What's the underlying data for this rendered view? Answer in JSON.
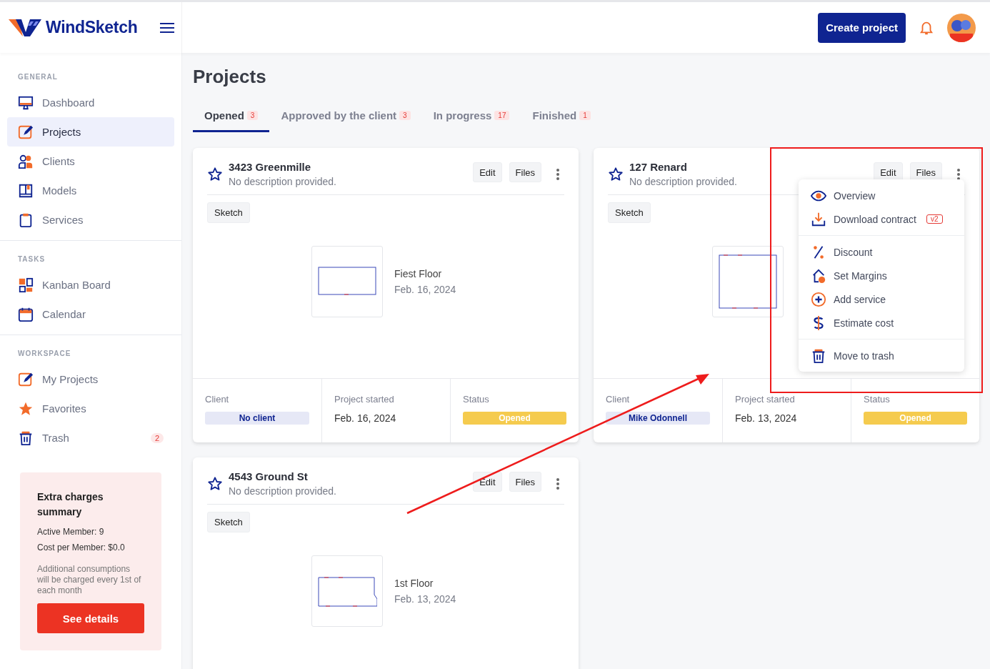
{
  "logo": {
    "name": "WindSketch"
  },
  "header": {
    "create_button": "Create project"
  },
  "sidebar": {
    "sections": [
      {
        "title": "GENERAL",
        "items": [
          {
            "label": "Dashboard",
            "selected": false
          },
          {
            "label": "Projects",
            "selected": true
          },
          {
            "label": "Clients",
            "selected": false
          },
          {
            "label": "Models",
            "selected": false
          },
          {
            "label": "Services",
            "selected": false
          }
        ]
      },
      {
        "title": "TASKS",
        "items": [
          {
            "label": "Kanban Board",
            "selected": false
          },
          {
            "label": "Calendar",
            "selected": false
          }
        ]
      },
      {
        "title": "WORKSPACE",
        "items": [
          {
            "label": "My Projects",
            "selected": false
          },
          {
            "label": "Favorites",
            "selected": false
          },
          {
            "label": "Trash",
            "selected": false,
            "badge": "2"
          }
        ]
      }
    ]
  },
  "extra_charges": {
    "title": "Extra charges summary",
    "lines": [
      "Active Member: 9",
      "Cost per Member: $0.0"
    ],
    "note": "Additional consumptions will be charged every 1st of each month",
    "button": "See details"
  },
  "page": {
    "title": "Projects"
  },
  "tabs": [
    {
      "label": "Opened",
      "count": "3",
      "selected": true
    },
    {
      "label": "Approved by the client",
      "count": "3",
      "selected": false
    },
    {
      "label": "In progress",
      "count": "17",
      "selected": false
    },
    {
      "label": "Finished",
      "count": "1",
      "selected": false
    }
  ],
  "projects": [
    {
      "title": "3423 Greenmille",
      "description": "No description provided.",
      "actions": [
        "Edit",
        "Files"
      ],
      "tag": "Sketch",
      "sketch": {
        "label": "Fiest Floor",
        "date": "Feb. 16, 2024"
      },
      "footer": [
        {
          "kind": "client",
          "label": "Client",
          "value": "No client"
        },
        {
          "kind": "date",
          "label": "Project started",
          "value": "Feb. 16, 2024"
        },
        {
          "kind": "status",
          "label": "Status",
          "value": "Opened"
        }
      ]
    },
    {
      "title": "127 Renard",
      "description": "No description provided.",
      "actions": [
        "Edit",
        "Files"
      ],
      "tag": "Sketch",
      "footer": [
        {
          "kind": "client",
          "label": "Client",
          "value": "Mike Odonnell"
        },
        {
          "kind": "date",
          "label": "Project started",
          "value": "Feb. 13, 2024"
        },
        {
          "kind": "status",
          "label": "Status",
          "value": "Opened"
        }
      ],
      "menu": {
        "groups": [
          [
            {
              "label": "Overview"
            },
            {
              "label": "Download contract",
              "badge": "v2"
            }
          ],
          [
            {
              "label": "Discount"
            },
            {
              "label": "Set Margins"
            },
            {
              "label": "Add service"
            },
            {
              "label": "Estimate cost"
            }
          ],
          [
            {
              "label": "Move to trash"
            }
          ]
        ]
      }
    },
    {
      "title": "4543 Ground St",
      "description": "No description provided.",
      "actions": [
        "Edit",
        "Files"
      ],
      "tag": "Sketch",
      "sketch": {
        "label": "1st Floor",
        "date": "Feb. 13, 2024"
      }
    }
  ]
}
